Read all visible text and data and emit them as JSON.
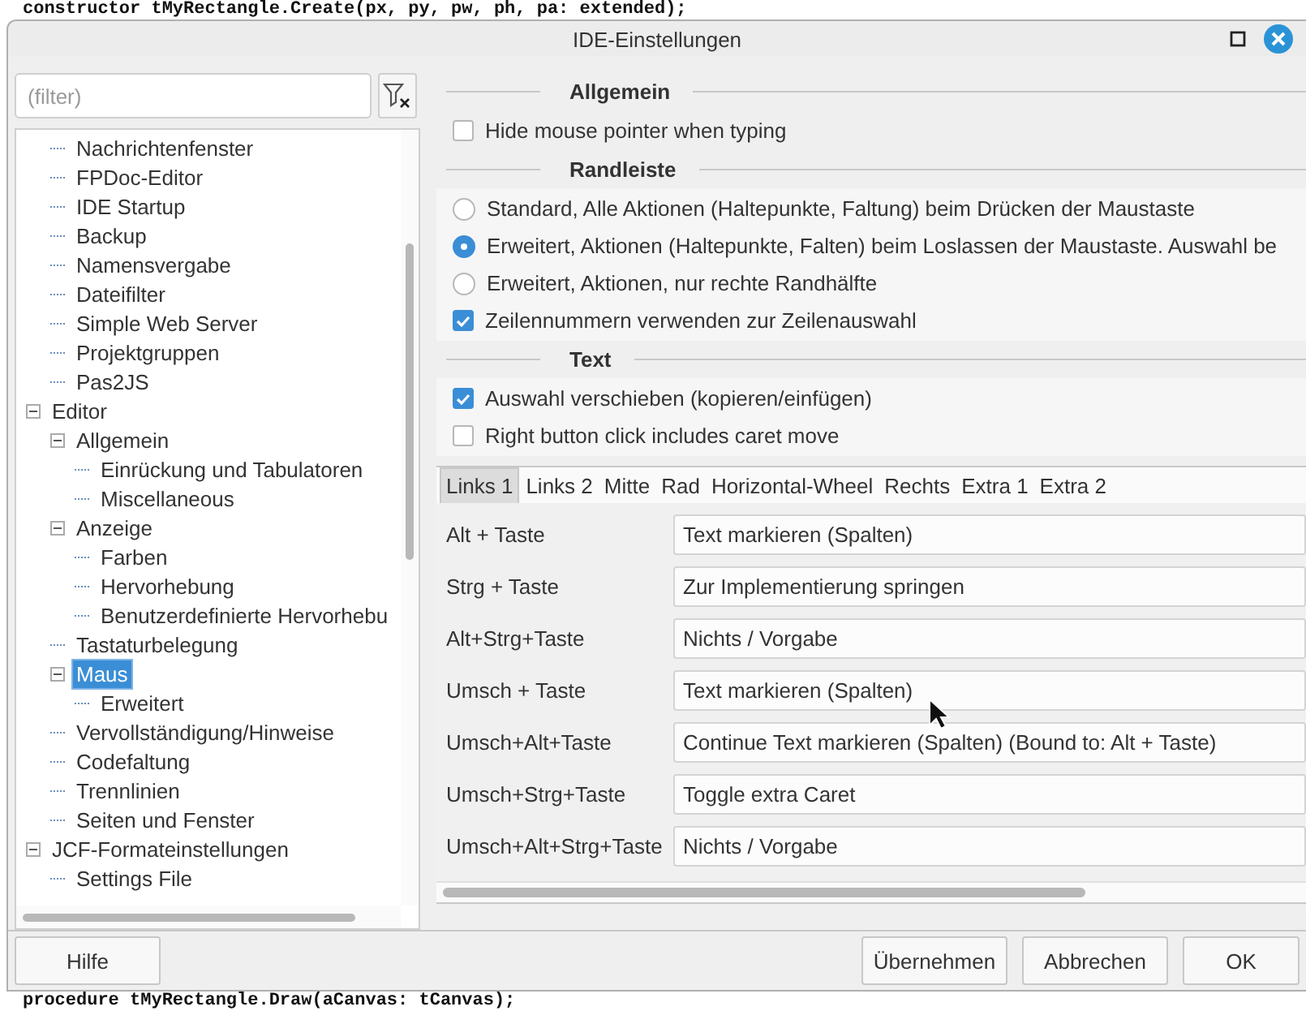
{
  "editor_background": {
    "lines": [
      "constructor tMyRectangle.Create(px, py, pw, ph, pa: extended);",
      "procedure tMyRectangle.Draw(aCanvas: tCanvas);"
    ]
  },
  "window": {
    "title": "IDE-Einstellungen"
  },
  "filter": {
    "placeholder": "(filter)"
  },
  "tree": [
    {
      "children": [
        {
          "label": "Nachrichtenfenster",
          "selected": false
        },
        {
          "label": "FPDoc-Editor",
          "selected": false
        },
        {
          "label": "IDE Startup",
          "selected": false
        },
        {
          "label": "Backup",
          "selected": false
        },
        {
          "label": "Namensvergabe",
          "selected": false
        },
        {
          "label": "Dateifilter",
          "selected": false
        },
        {
          "label": "Simple Web Server",
          "selected": false
        },
        {
          "label": "Projektgruppen",
          "selected": false
        },
        {
          "label": "Pas2JS",
          "selected": false
        }
      ]
    },
    {
      "label": "Editor",
      "selected": false,
      "expanded": true,
      "children": [
        {
          "label": "Allgemein",
          "selected": false,
          "expanded": true,
          "children": [
            {
              "label": "Einrückung und Tabulatoren",
              "selected": false
            },
            {
              "label": "Miscellaneous",
              "selected": false
            }
          ]
        },
        {
          "label": "Anzeige",
          "selected": false,
          "expanded": true,
          "children": [
            {
              "label": "Farben",
              "selected": false
            },
            {
              "label": "Hervorhebung",
              "selected": false
            },
            {
              "label": "Benutzerdefinierte Hervorhebu",
              "selected": false
            }
          ]
        },
        {
          "label": "Tastaturbelegung",
          "selected": false
        },
        {
          "label": "Maus",
          "selected": true,
          "expanded": true,
          "children": [
            {
              "label": "Erweitert",
              "selected": false
            }
          ]
        },
        {
          "label": "Vervollständigung/Hinweise",
          "selected": false
        },
        {
          "label": "Codefaltung",
          "selected": false
        },
        {
          "label": "Trennlinien",
          "selected": false
        },
        {
          "label": "Seiten und Fenster",
          "selected": false
        }
      ]
    },
    {
      "label": "JCF-Formateinstellungen",
      "selected": false,
      "expanded": true,
      "children": [
        {
          "label": "Settings File",
          "selected": false
        }
      ]
    }
  ],
  "sections": [
    {
      "title": "Allgemein",
      "items": [
        {
          "kind": "checkbox",
          "label": "Hide mouse pointer when typing",
          "checked": false
        }
      ]
    },
    {
      "title": "Randleiste",
      "items": [
        {
          "kind": "radio",
          "label": "Standard, Alle Aktionen (Haltepunkte, Faltung) beim Drücken der Maustaste",
          "selected": false
        },
        {
          "kind": "radio",
          "label": "Erweitert, Aktionen (Haltepunkte, Falten) beim Loslassen der Maustaste. Auswahl be",
          "selected": true
        },
        {
          "kind": "radio",
          "label": "Erweitert, Aktionen, nur rechte Randhälfte",
          "selected": false
        },
        {
          "kind": "checkbox",
          "label": "Zeilennummern verwenden zur Zeilenauswahl",
          "checked": true
        }
      ]
    },
    {
      "title": "Text",
      "items": [
        {
          "kind": "checkbox",
          "label": "Auswahl verschieben (kopieren/einfügen)",
          "checked": true
        },
        {
          "kind": "checkbox",
          "label": "Right button click includes caret move",
          "checked": false
        }
      ]
    }
  ],
  "mouse_tabs": [
    {
      "label": "Links 1",
      "selected": true
    },
    {
      "label": "Links 2",
      "selected": false
    },
    {
      "label": "Mitte",
      "selected": false
    },
    {
      "label": "Rad",
      "selected": false
    },
    {
      "label": "Horizontal-Wheel",
      "selected": false
    },
    {
      "label": "Rechts",
      "selected": false
    },
    {
      "label": "Extra 1",
      "selected": false
    },
    {
      "label": "Extra 2",
      "selected": false
    }
  ],
  "mouse_actions": [
    {
      "label": "Alt + Taste",
      "value": "Text markieren (Spalten)"
    },
    {
      "label": "Strg + Taste",
      "value": "Zur Implementierung springen"
    },
    {
      "label": "Alt+Strg+Taste",
      "value": "Nichts / Vorgabe"
    },
    {
      "label": "Umsch + Taste",
      "value": "Text markieren (Spalten)"
    },
    {
      "label": "Umsch+Alt+Taste",
      "value": "Continue Text markieren (Spalten) (Bound to: Alt + Taste)"
    },
    {
      "label": "Umsch+Strg+Taste",
      "value": "Toggle extra Caret"
    },
    {
      "label": "Umsch+Alt+Strg+Taste",
      "value": "Nichts / Vorgabe"
    }
  ],
  "buttons": [
    {
      "kind": "help",
      "label": "Hilfe"
    },
    {
      "kind": "action",
      "label": "Übernehmen"
    },
    {
      "kind": "action",
      "label": "Abbrechen"
    },
    {
      "kind": "action",
      "label": "OK"
    }
  ]
}
